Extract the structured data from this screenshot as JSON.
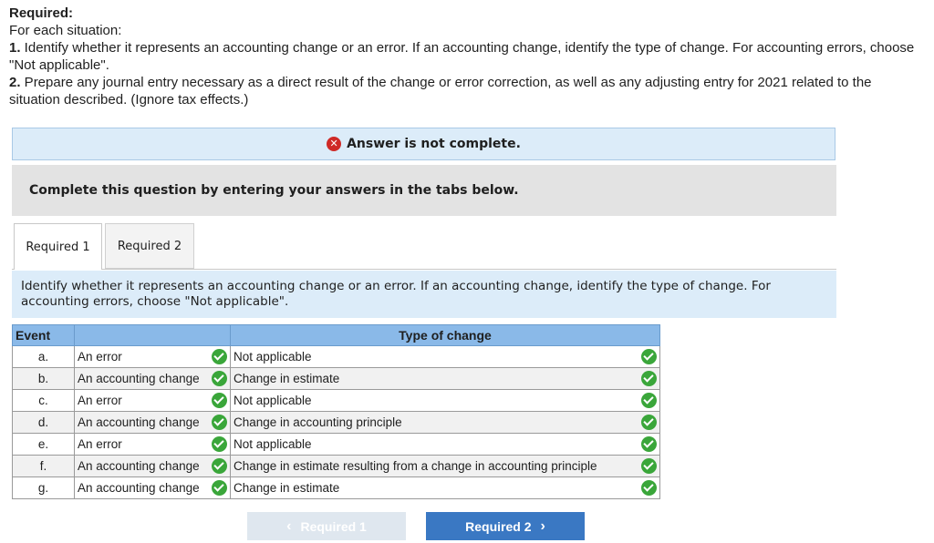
{
  "instructions": {
    "title": "Required:",
    "line1": "For each situation:",
    "item1_num": "1.",
    "item1_text": " Identify whether it represents an accounting change or an error. If an accounting change, identify the type of change.  For accounting errors, choose \"Not applicable\".",
    "item2_num": "2.",
    "item2_text": " Prepare any journal entry necessary as a direct result of the change or error correction, as well as any adjusting entry for 2021 related to the situation described. (Ignore tax effects.)"
  },
  "banner": {
    "icon": "x-icon",
    "text": "Answer is not complete."
  },
  "complete_box": {
    "text": "Complete this question by entering your answers in the tabs below."
  },
  "tabs": [
    {
      "label": "Required 1",
      "active": true
    },
    {
      "label": "Required 2",
      "active": false
    }
  ],
  "question": {
    "text": "Identify whether it represents an accounting change or an error. If an accounting change, identify the type of change.  For accounting errors, choose \"Not applicable\"."
  },
  "table": {
    "headers": {
      "event": "Event",
      "kind": "",
      "type": "Type of change"
    },
    "rows": [
      {
        "event": "a.",
        "kind": "An error",
        "type": "Not applicable"
      },
      {
        "event": "b.",
        "kind": "An accounting change",
        "type": "Change in estimate"
      },
      {
        "event": "c.",
        "kind": "An error",
        "type": "Not applicable"
      },
      {
        "event": "d.",
        "kind": "An accounting change",
        "type": "Change in accounting principle"
      },
      {
        "event": "e.",
        "kind": "An error",
        "type": "Not applicable"
      },
      {
        "event": "f.",
        "kind": "An accounting change",
        "type": "Change in estimate resulting from a change in accounting principle"
      },
      {
        "event": "g.",
        "kind": "An accounting change",
        "type": "Change in estimate"
      }
    ]
  },
  "nav": {
    "prev_label": "Required 1",
    "next_label": "Required 2"
  },
  "colors": {
    "header_blue": "#8ab9e8",
    "next_button": "#3a78c3",
    "check_green": "#3aa63a",
    "error_red": "#cf2a27"
  }
}
